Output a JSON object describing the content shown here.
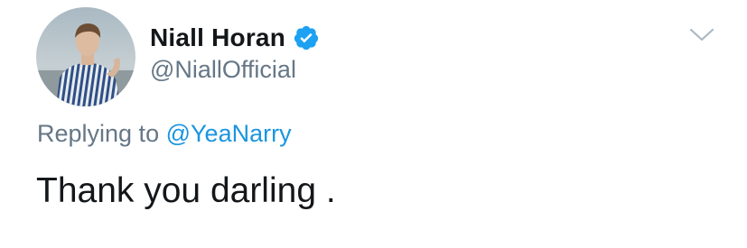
{
  "author": {
    "display_name": "Niall Horan",
    "handle": "@NiallOfficial",
    "verified": true,
    "avatar_icon": "profile-photo"
  },
  "reply": {
    "prefix": "Replying to",
    "handle": "@YeaNarry"
  },
  "tweet": {
    "text": "Thank you darling ."
  },
  "icons": {
    "verified": "verified-badge-icon",
    "menu": "chevron-down-icon"
  },
  "colors": {
    "verified_blue": "#1da1f2",
    "link_blue": "#1b95e0",
    "secondary_text": "#657786",
    "primary_text": "#14171a",
    "chevron": "#aab8c2"
  }
}
